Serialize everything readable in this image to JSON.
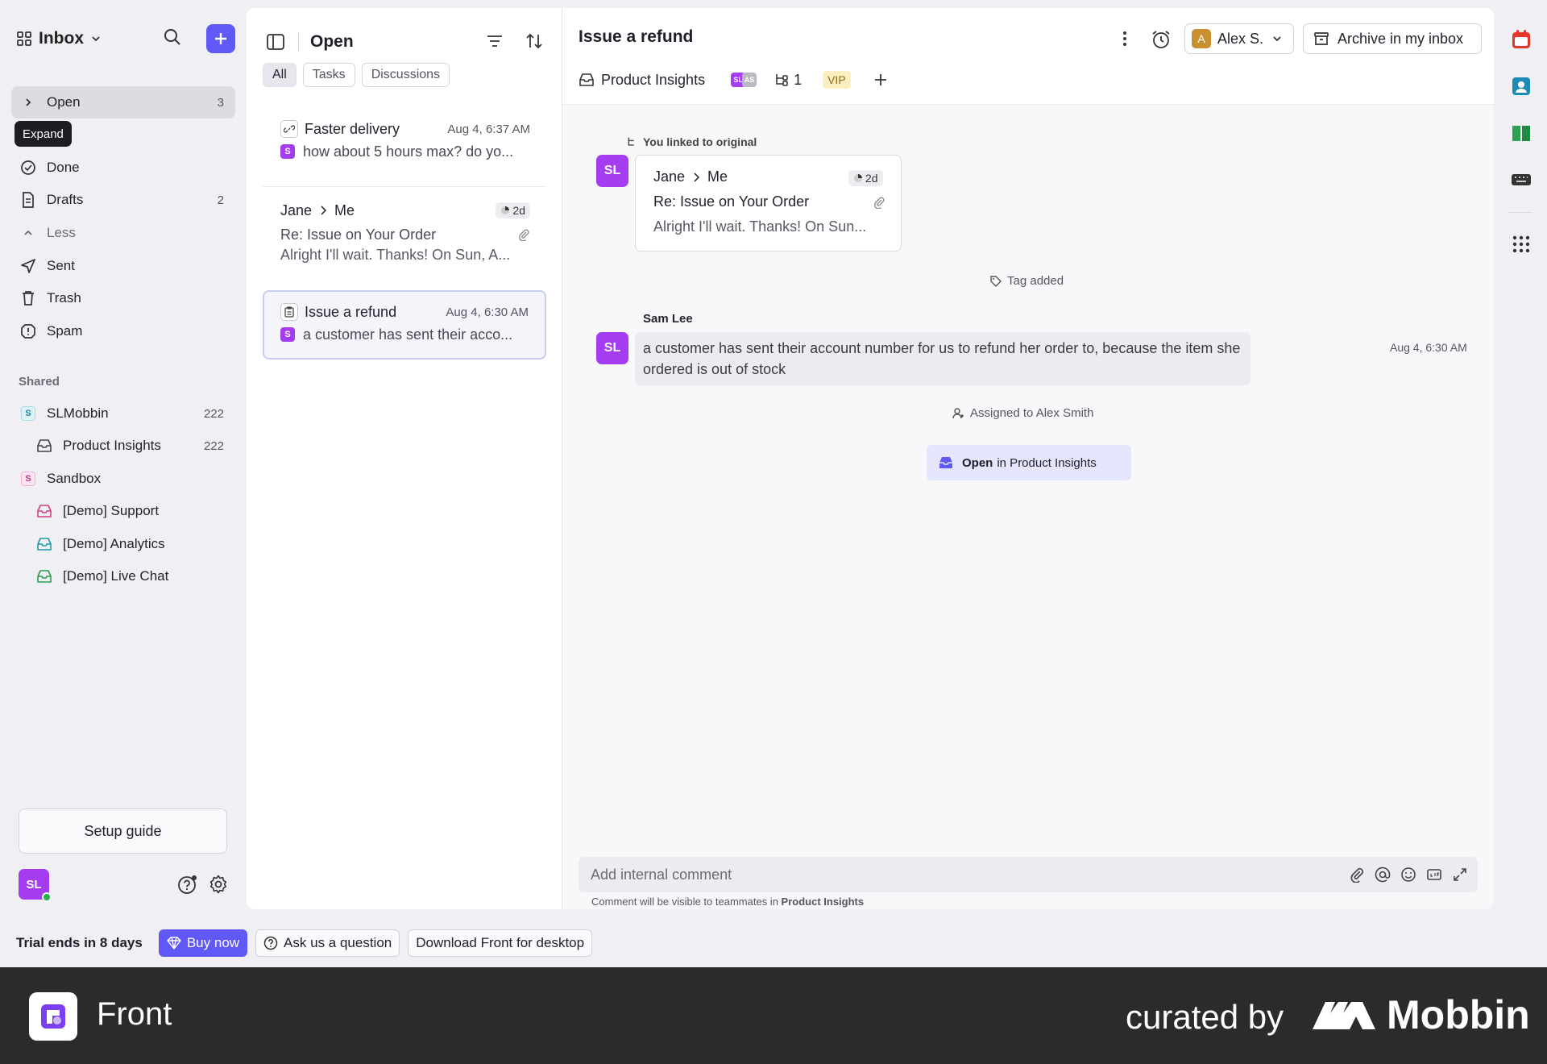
{
  "sidebar": {
    "inbox_label": "Inbox",
    "tooltip": "Expand",
    "items": [
      {
        "label": "Open",
        "count": "3"
      },
      {
        "label": "Done",
        "count": ""
      },
      {
        "label": "Drafts",
        "count": "2"
      },
      {
        "label": "Less",
        "count": ""
      },
      {
        "label": "Sent",
        "count": ""
      },
      {
        "label": "Trash",
        "count": ""
      },
      {
        "label": "Spam",
        "count": ""
      }
    ],
    "shared_label": "Shared",
    "shared": [
      {
        "label": "SLMobbin",
        "count": "222",
        "badge": "S"
      },
      {
        "label": "Product Insights",
        "count": "222"
      },
      {
        "label": "Sandbox",
        "count": "",
        "badge": "S"
      },
      {
        "label": "[Demo] Support",
        "count": ""
      },
      {
        "label": "[Demo] Analytics",
        "count": ""
      },
      {
        "label": "[Demo] Live Chat",
        "count": ""
      }
    ],
    "setup_guide": "Setup guide",
    "user_initials": "SL"
  },
  "list": {
    "title": "Open",
    "filters": [
      "All",
      "Tasks",
      "Discussions"
    ],
    "conversations": [
      {
        "subject": "Faster delivery",
        "time": "Aug 4, 6:37 AM",
        "badge": "S",
        "preview": "how about 5 hours max? do yo..."
      },
      {
        "from": "Jane",
        "to": "Me",
        "age": "2d",
        "subject": "Re: Issue on Your Order",
        "preview": "Alright I'll wait. Thanks! On Sun, A..."
      },
      {
        "subject": "Issue a refund",
        "time": "Aug 4, 6:30 AM",
        "badge": "S",
        "preview": "a customer has sent their acco..."
      }
    ]
  },
  "main": {
    "subject": "Issue a refund",
    "assignee_initial": "A",
    "assignee": "Alex S.",
    "archive_label": "Archive in my inbox",
    "inbox_tag": "Product Insights",
    "avatars": [
      "SL",
      "AS"
    ],
    "link_count": "1",
    "vip": "VIP",
    "linked_note": "You linked to original",
    "linked_card": {
      "from": "Jane",
      "to": "Me",
      "age": "2d",
      "subject": "Re: Issue on Your Order",
      "preview": "Alright I'll wait. Thanks! On Sun..."
    },
    "tag_added": "Tag added",
    "message": {
      "author": "Sam Lee",
      "initials": "SL",
      "text": "a customer has sent their account number for us to refund her order to, because the item she ordered is out of stock",
      "time": "Aug 4, 6:30 AM"
    },
    "assigned_note": "Assigned to Alex Smith",
    "open_in_bold": "Open",
    "open_in_rest": "in Product Insights",
    "comment_placeholder": "Add internal comment",
    "comment_note_prefix": "Comment will be visible to teammates in",
    "comment_note_inbox": "Product Insights"
  },
  "bottom": {
    "trial": "Trial ends in 8 days",
    "buy": "Buy now",
    "ask": "Ask us a question",
    "download": "Download Front for desktop"
  },
  "footer": {
    "app_name": "Front",
    "curated": "curated by",
    "brand": "Mobbin"
  },
  "colors": {
    "accent": "#6159f6",
    "avatar": "#a43df0",
    "vip_bg": "#fbefc2"
  }
}
